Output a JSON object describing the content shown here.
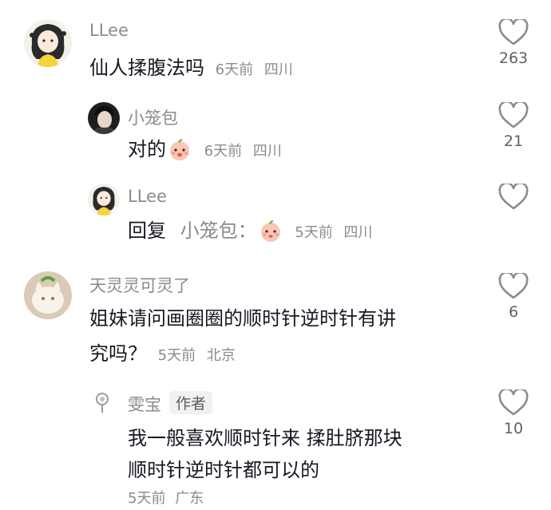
{
  "comments": [
    {
      "author": "LLee",
      "text": "仙人揉腹法吗",
      "time": "6天前",
      "location": "四川",
      "likes": "263"
    },
    {
      "author": "小笼包",
      "text": "对的",
      "time": "6天前",
      "location": "四川",
      "likes": "21"
    },
    {
      "author": "LLee",
      "reply_label": "回复",
      "reply_to": "小笼包：",
      "time": "5天前",
      "location": "四川"
    },
    {
      "author": "天灵灵可灵了",
      "text_line1": "姐妹请问画圈圈的顺时针逆时针有讲",
      "text_line2": "究吗？",
      "time": "5天前",
      "location": "北京",
      "likes": "6"
    },
    {
      "author": "雯宝",
      "badge": "作者",
      "text_line1": "我一般喜欢顺时针来  揉肚脐那块",
      "text_line2": "顺时针逆时针都可以的",
      "time": "5天前",
      "location": "广东",
      "likes": "10"
    }
  ],
  "icons": {
    "like": "heart-outline-icon",
    "emoji": "peach-face-emoji"
  },
  "colors": {
    "name_gray": "#8a8b91",
    "text": "#161823",
    "heart_stroke": "#8a8b91"
  }
}
